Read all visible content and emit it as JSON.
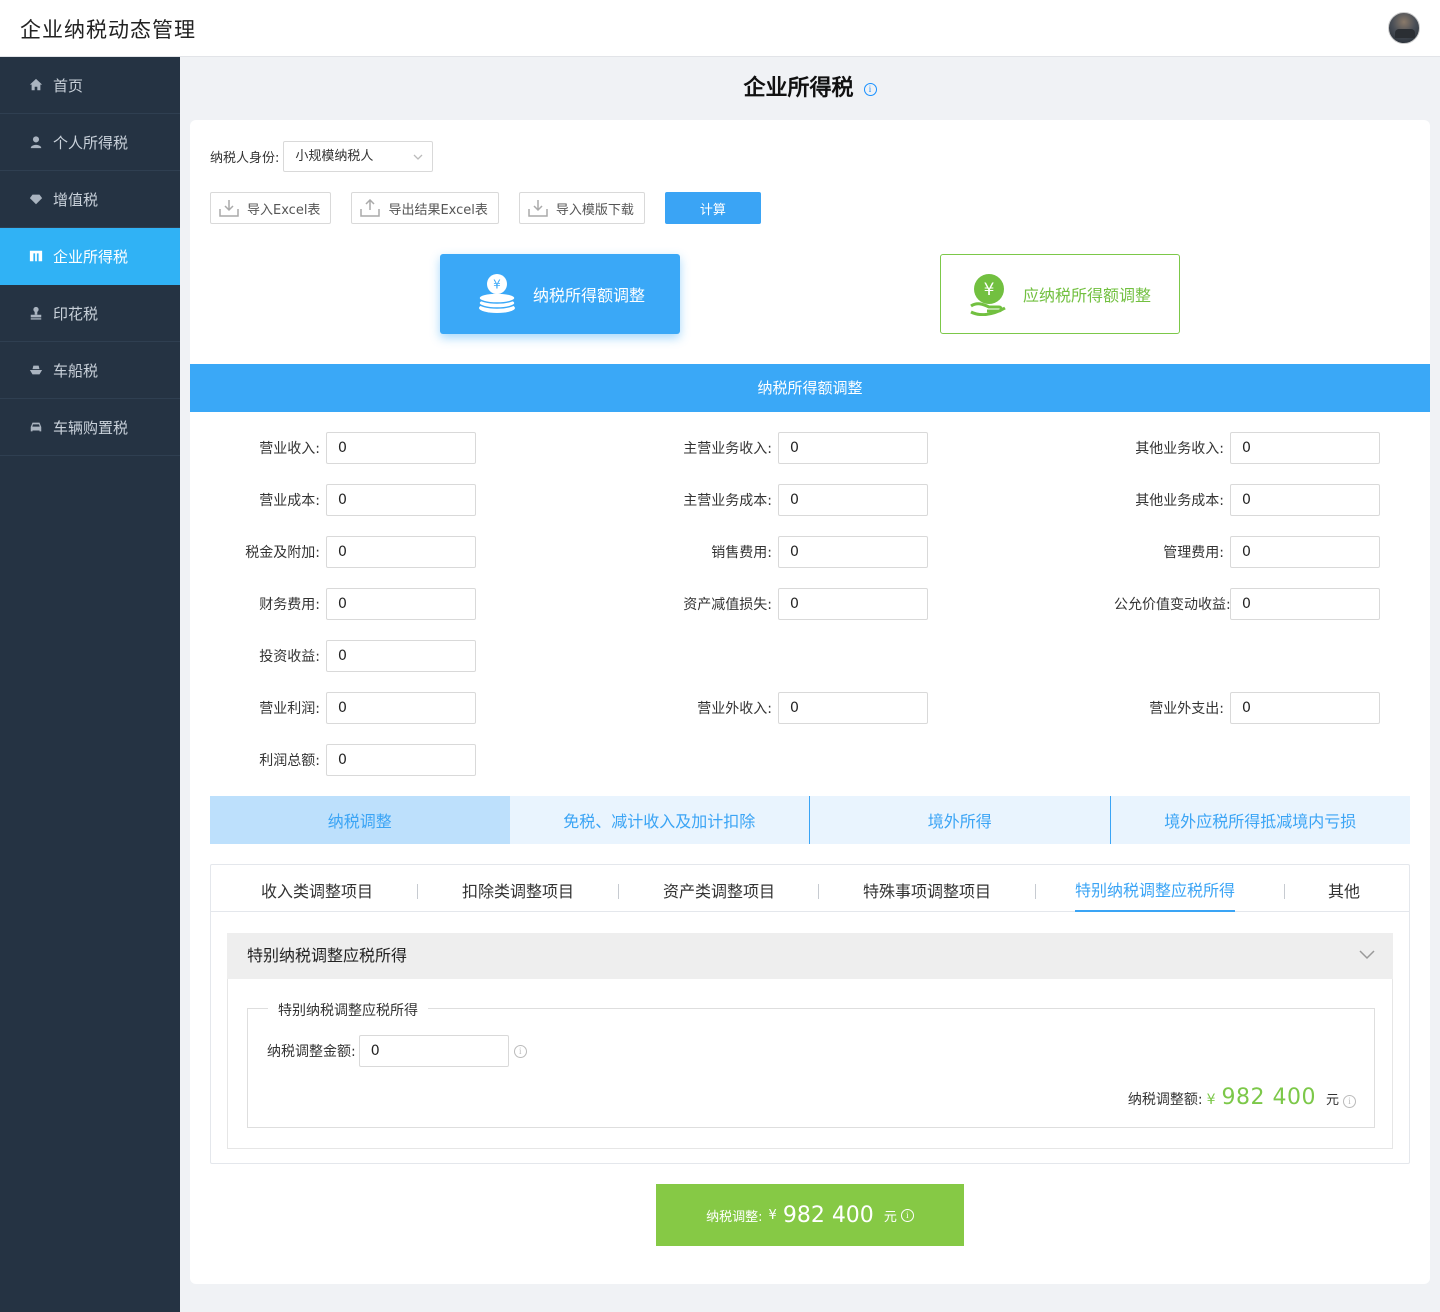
{
  "header": {
    "title": "企业纳税动态管理"
  },
  "sidebar": {
    "items": [
      {
        "label": "首页",
        "icon": "home-icon"
      },
      {
        "label": "个人所得税",
        "icon": "user-icon"
      },
      {
        "label": "增值税",
        "icon": "diamond-icon"
      },
      {
        "label": "企业所得税",
        "icon": "building-icon",
        "active": true
      },
      {
        "label": "印花税",
        "icon": "stamp-icon"
      },
      {
        "label": "车船税",
        "icon": "ship-icon"
      },
      {
        "label": "车辆购置税",
        "icon": "car-icon"
      }
    ]
  },
  "page": {
    "title": "企业所得税",
    "info_icon": "i"
  },
  "identity": {
    "label": "纳税人身份:",
    "value": "小规模纳税人"
  },
  "toolbar": {
    "import_excel": "导入Excel表",
    "export_excel": "导出结果Excel表",
    "template_download": "导入模版下载",
    "calculate": "计算"
  },
  "modes": {
    "primary": "纳税所得额调整",
    "secondary": "应纳税所得额调整"
  },
  "section_title": "纳税所得额调整",
  "fields": {
    "r1": [
      {
        "label": "营业收入:",
        "value": "0"
      },
      {
        "label": "主营业务收入:",
        "value": "0"
      },
      {
        "label": "其他业务收入:",
        "value": "0"
      }
    ],
    "r2": [
      {
        "label": "营业成本:",
        "value": "0"
      },
      {
        "label": "主营业务成本:",
        "value": "0"
      },
      {
        "label": "其他业务成本:",
        "value": "0"
      }
    ],
    "r3": [
      {
        "label": "税金及附加:",
        "value": "0"
      },
      {
        "label": "销售费用:",
        "value": "0"
      },
      {
        "label": "管理费用:",
        "value": "0"
      }
    ],
    "r4": [
      {
        "label": "财务费用:",
        "value": "0"
      },
      {
        "label": "资产减值损失:",
        "value": "0"
      },
      {
        "label": "公允价值变动收益:",
        "value": "0"
      }
    ],
    "r5": [
      {
        "label": "投资收益:",
        "value": "0"
      }
    ],
    "r6": [
      {
        "label": "营业利润:",
        "value": "0"
      },
      {
        "label": "营业外收入:",
        "value": "0"
      },
      {
        "label": "营业外支出:",
        "value": "0"
      }
    ],
    "r7": [
      {
        "label": "利润总额:",
        "value": "0"
      }
    ]
  },
  "main_tabs": [
    "纳税调整",
    "免税、减计收入及加计扣除",
    "境外所得",
    "境外应税所得抵减境内亏损"
  ],
  "sub_tabs": [
    "收入类调整项目",
    "扣除类调整项目",
    "资产类调整项目",
    "特殊事项调整项目",
    "特别纳税调整应税所得",
    "其他"
  ],
  "collapse": {
    "title": "特别纳税调整应税所得",
    "legend": "特别纳税调整应税所得",
    "amount_label": "纳税调整金额:",
    "amount_value": "0",
    "total_label": "纳税调整额:",
    "currency": "¥",
    "total_value": "982 400",
    "unit": "元"
  },
  "result": {
    "label": "纳税调整:",
    "currency": "¥",
    "value": "982 400",
    "unit": "元"
  },
  "colors": {
    "primary": "#3aa8f7",
    "sidebar": "#253343",
    "success": "#86c945"
  }
}
